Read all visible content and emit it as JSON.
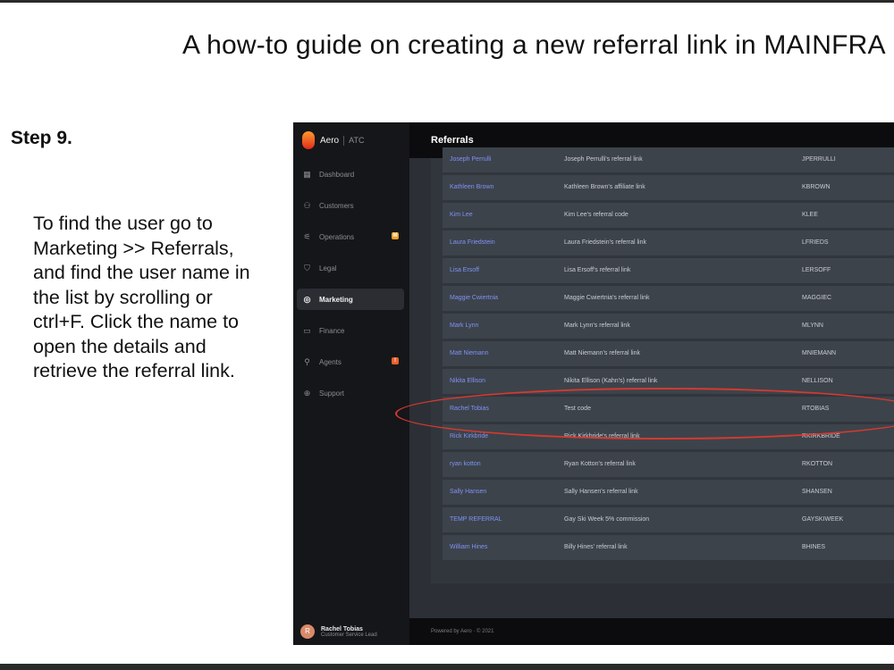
{
  "guide": {
    "title": "A how-to guide on creating a new referral link in MAINFRA",
    "step": "Step 9.",
    "instructions": "To find the user go to Marketing >> Referrals, and find the user name in the list by scrolling or ctrl+F. Click the name to open the details and retrieve the referral link."
  },
  "app": {
    "brand": "Aero",
    "brand_sub": "ATC",
    "page_title": "Referrals",
    "footer": "Powered by Aero · © 2021",
    "nav": [
      {
        "label": "Dashboard",
        "icon": "dashboard-icon",
        "glyph": "▦"
      },
      {
        "label": "Customers",
        "icon": "customers-icon",
        "glyph": "⚇"
      },
      {
        "label": "Operations",
        "icon": "operations-icon",
        "glyph": "⚟",
        "badge": "M",
        "badge_color": "#f0a02a"
      },
      {
        "label": "Legal",
        "icon": "legal-icon",
        "glyph": "⛉"
      },
      {
        "label": "Marketing",
        "icon": "marketing-icon",
        "glyph": "◎",
        "active": true
      },
      {
        "label": "Finance",
        "icon": "finance-icon",
        "glyph": "▭"
      },
      {
        "label": "Agents",
        "icon": "agents-icon",
        "glyph": "⚲",
        "badge": "!",
        "badge_color": "#e8622a"
      },
      {
        "label": "Support",
        "icon": "support-icon",
        "glyph": "⊕"
      }
    ],
    "user": {
      "initial": "R",
      "name": "Rachel Tobias",
      "role": "Customer Service Lead"
    },
    "rows": [
      {
        "name": "Joseph Perrulli",
        "description": "Joseph Perrulli's referral link",
        "code": "JPERRULLI"
      },
      {
        "name": "Kathleen Brown",
        "description": "Kathleen Brown's affiliate link",
        "code": "KBROWN"
      },
      {
        "name": "Kim Lee",
        "description": "Kim Lee's referral code",
        "code": "KLEE"
      },
      {
        "name": "Laura Friedstein",
        "description": "Laura Friedstein's referral link",
        "code": "LFRIEDS"
      },
      {
        "name": "Lisa Ersoff",
        "description": "Lisa Ersoff's referral link",
        "code": "LERSOFF"
      },
      {
        "name": "Maggie Cwiertnia",
        "description": "Maggie Cwiertnia's referral link",
        "code": "MAGGIEC"
      },
      {
        "name": "Mark Lynn",
        "description": "Mark Lynn's referral link",
        "code": "MLYNN"
      },
      {
        "name": "Matt Niemann",
        "description": "Matt Niemann's referral link",
        "code": "MNIEMANN"
      },
      {
        "name": "Nikita Ellison",
        "description": "Nikita Ellison (Kahn's) referral link",
        "code": "NELLISON"
      },
      {
        "name": "Rachel Tobias",
        "description": "Test code",
        "code": "RTOBIAS"
      },
      {
        "name": "Rick Kirkbride",
        "description": "Rick Kirkbride's referral link",
        "code": "RKIRKBRIDE"
      },
      {
        "name": "ryan kotton",
        "description": "Ryan Kotton's referral link",
        "code": "RKOTTON"
      },
      {
        "name": "Sally Hansen",
        "description": "Sally Hansen's referral link",
        "code": "SHANSEN"
      },
      {
        "name": "TEMP REFERRAL",
        "description": "Gay Ski Week 5% commission",
        "code": "GAYSKIWEEK"
      },
      {
        "name": "William Hines",
        "description": "Billy Hines' referral link",
        "code": "BHINES"
      }
    ]
  }
}
